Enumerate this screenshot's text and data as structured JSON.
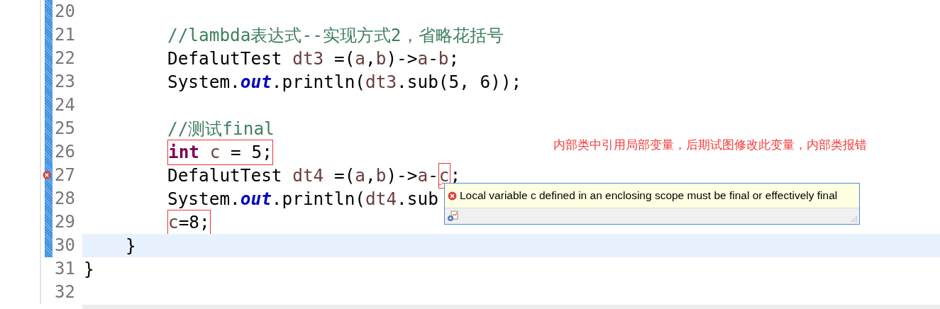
{
  "lines": [
    {
      "number": "20",
      "kind": "blank",
      "changed": true,
      "current": false,
      "error": false
    },
    {
      "number": "21",
      "kind": "statement",
      "changed": true,
      "current": false,
      "error": false,
      "segments": [
        {
          "boxed": false,
          "tokens": [
            {
              "kind": "comment",
              "text": "//lambda表达式--实现方式2，省略花括号"
            }
          ]
        }
      ]
    },
    {
      "number": "22",
      "kind": "statement",
      "changed": true,
      "current": false,
      "error": false,
      "segments": [
        {
          "boxed": false,
          "tokens": [
            {
              "kind": "plain",
              "text": "DefalutTest"
            },
            {
              "kind": "var",
              "text": " dt3"
            },
            {
              "kind": "plain",
              "text": " =("
            },
            {
              "kind": "var",
              "text": "a"
            },
            {
              "kind": "plain",
              "text": ","
            },
            {
              "kind": "var",
              "text": "b"
            },
            {
              "kind": "plain",
              "text": ")->"
            },
            {
              "kind": "var",
              "text": "a"
            },
            {
              "kind": "plain",
              "text": "-"
            },
            {
              "kind": "var",
              "text": "b"
            },
            {
              "kind": "plain",
              "text": ";"
            }
          ]
        }
      ]
    },
    {
      "number": "23",
      "kind": "statement",
      "changed": true,
      "current": false,
      "error": false,
      "segments": [
        {
          "boxed": false,
          "tokens": [
            {
              "kind": "plain",
              "text": "System."
            },
            {
              "kind": "field",
              "text": "out"
            },
            {
              "kind": "plain",
              "text": ".println("
            },
            {
              "kind": "var",
              "text": "dt3"
            },
            {
              "kind": "plain",
              "text": ".sub(5, 6));"
            }
          ]
        }
      ]
    },
    {
      "number": "24",
      "kind": "blank",
      "changed": true,
      "current": false,
      "error": false
    },
    {
      "number": "25",
      "kind": "statement",
      "changed": true,
      "current": false,
      "error": false,
      "segments": [
        {
          "boxed": false,
          "tokens": [
            {
              "kind": "comment",
              "text": "//测试final"
            }
          ]
        }
      ]
    },
    {
      "number": "26",
      "kind": "statement",
      "changed": true,
      "current": false,
      "error": false,
      "segments": [
        {
          "boxed": true,
          "tokens": [
            {
              "kind": "keyword",
              "text": "int"
            },
            {
              "kind": "var",
              "text": " c"
            },
            {
              "kind": "plain",
              "text": " = 5;"
            }
          ]
        }
      ]
    },
    {
      "number": "27",
      "kind": "statement",
      "changed": true,
      "current": false,
      "error": true,
      "segments": [
        {
          "boxed": false,
          "tokens": [
            {
              "kind": "plain",
              "text": "DefalutTest"
            },
            {
              "kind": "var",
              "text": " dt4"
            },
            {
              "kind": "plain",
              "text": " =("
            },
            {
              "kind": "var",
              "text": "a"
            },
            {
              "kind": "plain",
              "text": ","
            },
            {
              "kind": "var",
              "text": "b"
            },
            {
              "kind": "plain",
              "text": ")->"
            },
            {
              "kind": "var",
              "text": "a"
            },
            {
              "kind": "plain",
              "text": "-"
            }
          ]
        },
        {
          "boxed": true,
          "tokens": [
            {
              "kind": "error",
              "text": "c"
            }
          ]
        },
        {
          "boxed": false,
          "tokens": [
            {
              "kind": "plain",
              "text": ";"
            }
          ]
        }
      ]
    },
    {
      "number": "28",
      "kind": "statement",
      "changed": true,
      "current": false,
      "error": false,
      "segments": [
        {
          "boxed": false,
          "tokens": [
            {
              "kind": "plain",
              "text": "System."
            },
            {
              "kind": "field",
              "text": "out"
            },
            {
              "kind": "plain",
              "text": ".println("
            },
            {
              "kind": "var",
              "text": "dt4"
            },
            {
              "kind": "plain",
              "text": ".sub"
            }
          ]
        }
      ]
    },
    {
      "number": "29",
      "kind": "statement",
      "changed": true,
      "current": false,
      "error": false,
      "segments": [
        {
          "boxed": true,
          "tokens": [
            {
              "kind": "var",
              "text": "c"
            },
            {
              "kind": "plain",
              "text": "=8;"
            }
          ]
        }
      ]
    },
    {
      "number": "30",
      "kind": "method_close",
      "changed": true,
      "current": true,
      "error": false,
      "segments": [
        {
          "boxed": false,
          "tokens": [
            {
              "kind": "plain",
              "text": "}"
            }
          ]
        }
      ]
    },
    {
      "number": "31",
      "kind": "class_close",
      "changed": false,
      "current": false,
      "error": false,
      "segments": [
        {
          "boxed": false,
          "tokens": [
            {
              "kind": "plain",
              "text": "}"
            }
          ]
        }
      ]
    },
    {
      "number": "32",
      "kind": "blank",
      "changed": false,
      "current": false,
      "error": false
    }
  ],
  "annotation": "内部类中引用局部变量，后期试图修改此变量，内部类报错",
  "tooltip": {
    "message": "Local variable c defined in an enclosing scope must be final or effectively final"
  }
}
